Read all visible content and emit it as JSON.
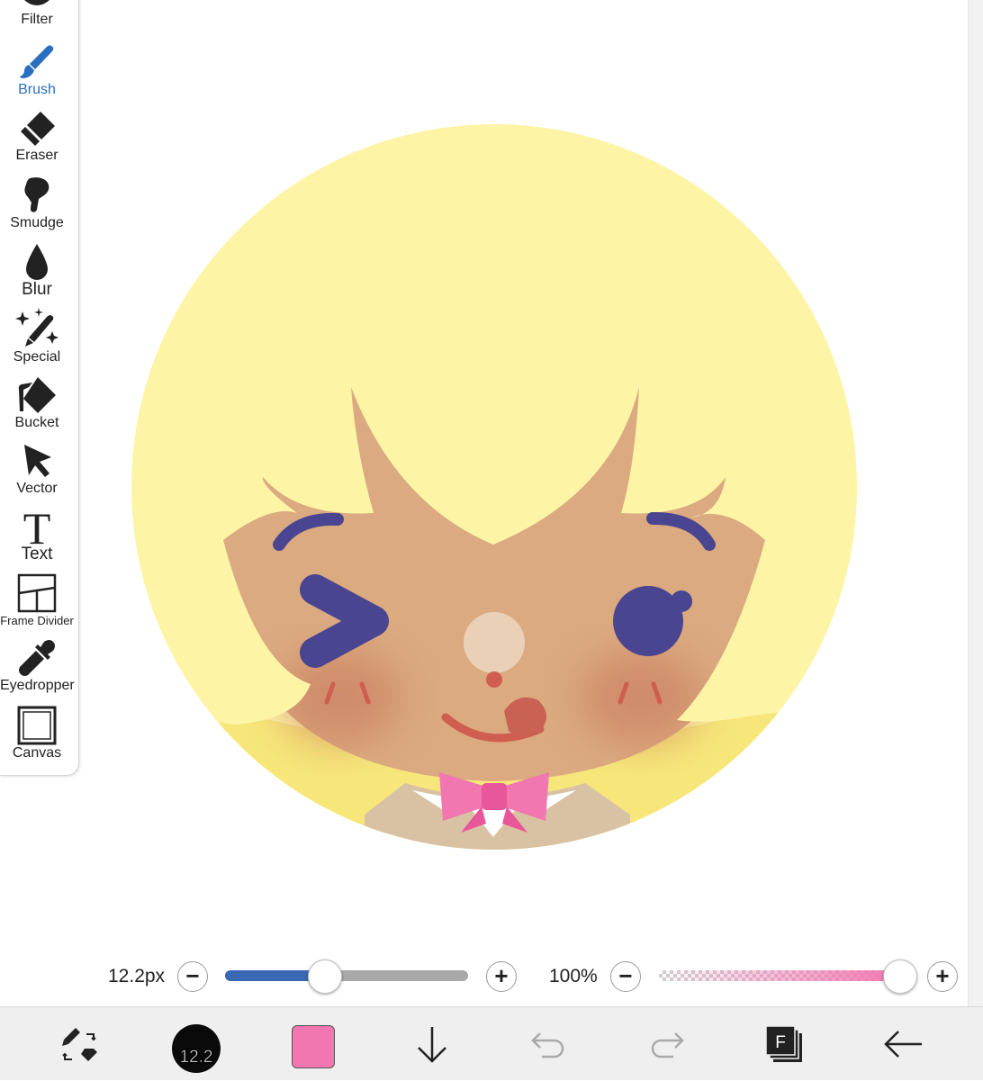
{
  "tools": [
    {
      "id": "filter",
      "label": "Filter",
      "icon": "filter-icon",
      "active": false
    },
    {
      "id": "brush",
      "label": "Brush",
      "icon": "brush-icon",
      "active": true
    },
    {
      "id": "eraser",
      "label": "Eraser",
      "icon": "eraser-icon",
      "active": false
    },
    {
      "id": "smudge",
      "label": "Smudge",
      "icon": "smudge-icon",
      "active": false
    },
    {
      "id": "blur",
      "label": "Blur",
      "icon": "blur-icon",
      "active": false
    },
    {
      "id": "special",
      "label": "Special",
      "icon": "special-icon",
      "active": false
    },
    {
      "id": "bucket",
      "label": "Bucket",
      "icon": "bucket-icon",
      "active": false
    },
    {
      "id": "vector",
      "label": "Vector",
      "icon": "vector-icon",
      "active": false
    },
    {
      "id": "text",
      "label": "Text",
      "icon": "text-icon",
      "active": false
    },
    {
      "id": "frame-divider",
      "label": "Frame Divider",
      "icon": "frame-divider-icon",
      "active": false
    },
    {
      "id": "eyedropper",
      "label": "Eyedropper",
      "icon": "eyedropper-icon",
      "active": false
    },
    {
      "id": "canvas",
      "label": "Canvas",
      "icon": "canvas-icon",
      "active": false
    }
  ],
  "controls": {
    "brush_size_label": "12.2px",
    "brush_size_fraction": 0.41,
    "opacity_label": "100%",
    "opacity_fraction": 1.0,
    "minus_symbol": "−",
    "plus_symbol": "+"
  },
  "bottom_bar": {
    "brush_size_badge": "12.2",
    "current_color": "#f276b0",
    "layers_letter": "F",
    "icons": [
      "swap-tool-icon",
      "brush-size-icon",
      "color-swatch",
      "download-icon",
      "undo-icon",
      "redo-icon",
      "layers-icon",
      "back-arrow-icon"
    ]
  },
  "colors": {
    "accent": "#2a6fc0",
    "slider_fill": "#3a68b4",
    "background_circle": "#fdf4a6",
    "hair": "#fdf4a6",
    "skin": "#dbaa80",
    "eyes": "#4a4590",
    "bow": "#f276b0"
  }
}
